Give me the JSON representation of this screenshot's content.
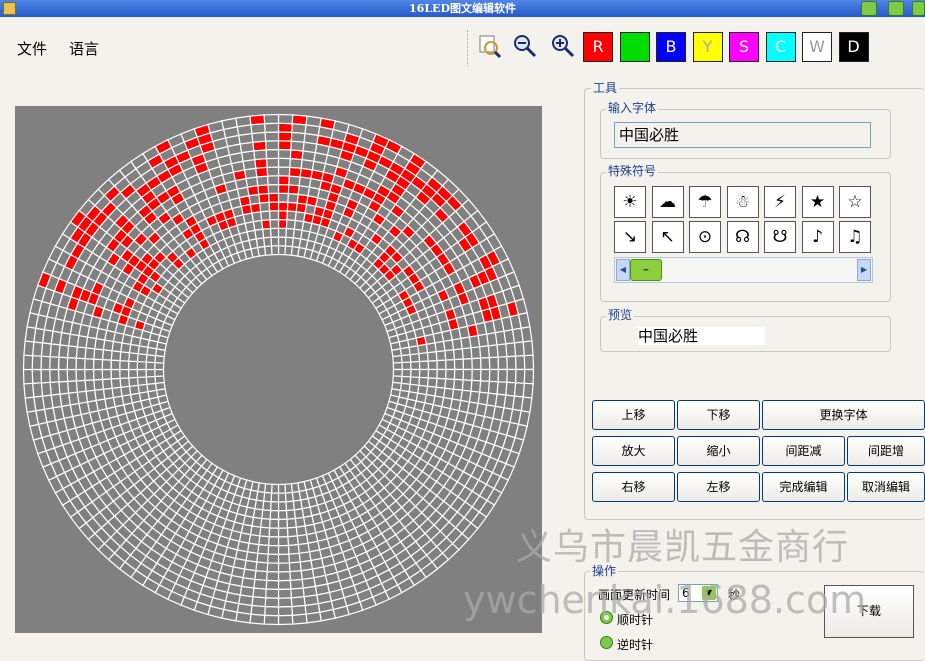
{
  "window": {
    "title": "16LED图文编辑软件"
  },
  "menu": {
    "file": "文件",
    "language": "语言"
  },
  "toolbar": {
    "icons": [
      "zoom-fit-icon",
      "zoom-out-icon",
      "zoom-in-icon"
    ],
    "colors": [
      {
        "label": "R",
        "bg": "#ff0000",
        "fg": "#ffffff"
      },
      {
        "label": "",
        "bg": "#00dd00",
        "fg": "#ffffff"
      },
      {
        "label": "B",
        "bg": "#0000ff",
        "fg": "#ffffff"
      },
      {
        "label": "Y",
        "bg": "#ffff00",
        "fg": "#aaaaaa"
      },
      {
        "label": "S",
        "bg": "#ff00ff",
        "fg": "#ffffff"
      },
      {
        "label": "C",
        "bg": "#00ffff",
        "fg": "#ffffff"
      },
      {
        "label": "W",
        "bg": "#ffffff",
        "fg": "#999999"
      },
      {
        "label": "D",
        "bg": "#000000",
        "fg": "#ffffff"
      }
    ]
  },
  "tools": {
    "title": "工具",
    "input_group": "输入字体",
    "input_value": "中国必胜",
    "symbols_group": "特殊符号",
    "symbols": [
      "☀",
      "☁",
      "☂",
      "☃",
      "⚡",
      "★",
      "☆",
      "↘",
      "↖",
      "⊙",
      "☊",
      "☋",
      "♪",
      "♫"
    ],
    "preview_group": "预览",
    "preview_value": "中国必胜"
  },
  "buttons": {
    "up": "上移",
    "down": "下移",
    "change_font": "更换字体",
    "zoom_in": "放大",
    "zoom_out": "缩小",
    "spacing_dec": "间距减",
    "spacing_inc": "间距增",
    "right": "右移",
    "left": "左移",
    "finish": "完成编辑",
    "cancel": "取消编辑"
  },
  "operation": {
    "title": "操作",
    "refresh_label": "画面更新时间",
    "refresh_value": "6",
    "unit": "秒",
    "clockwise": "顺时针",
    "counterclockwise": "逆时针",
    "selected": "clockwise",
    "download": "下载"
  },
  "watermark": {
    "line1": "义乌市晨凯五金商行",
    "line2": "ywchenkai.1688.com"
  },
  "display": {
    "lit_color": "#ff0000",
    "grid_color": "#ffffff",
    "bg_color": "#808080"
  }
}
